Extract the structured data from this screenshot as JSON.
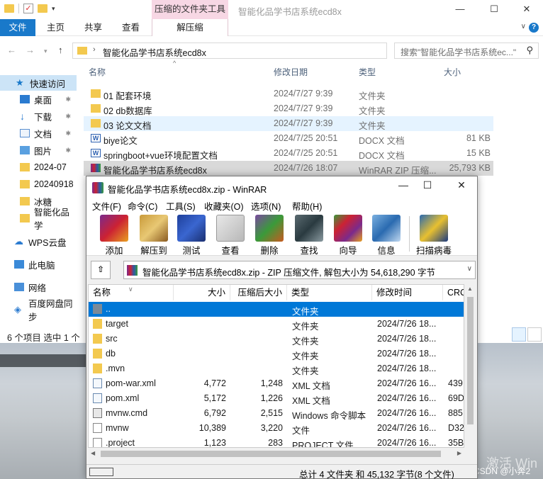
{
  "explorer": {
    "context_tab_title": "压缩的文件夹工具",
    "window_title": "智能化品学书店系统ecd8x",
    "window_controls": [
      "—",
      "☐",
      "✕"
    ],
    "ribbon": {
      "file": "文件",
      "home": "主页",
      "share": "共享",
      "view": "查看",
      "extract": "解压缩"
    },
    "address": {
      "path": "智能化品学书店系统ecd8x",
      "search_placeholder": "搜索\"智能化品学书店系统ec...\""
    },
    "nav_pane": [
      {
        "label": "快速访问",
        "icon": "star-icon",
        "selected": true
      },
      {
        "label": "桌面",
        "icon": "desktop-icon",
        "pinned": true
      },
      {
        "label": "下载",
        "icon": "download-icon",
        "pinned": true
      },
      {
        "label": "文档",
        "icon": "document-icon",
        "pinned": true
      },
      {
        "label": "图片",
        "icon": "picture-icon",
        "pinned": true
      },
      {
        "label": "2024-07",
        "icon": "folder-icon"
      },
      {
        "label": "20240918",
        "icon": "folder-icon"
      },
      {
        "label": "冰糖",
        "icon": "folder-icon"
      },
      {
        "label": "智能化品学",
        "icon": "folder-icon"
      },
      {
        "label": "WPS云盘",
        "icon": "cloud-icon"
      },
      {
        "label": "此电脑",
        "icon": "computer-icon"
      },
      {
        "label": "网络",
        "icon": "network-icon"
      },
      {
        "label": "百度网盘同步",
        "icon": "baidu-icon"
      }
    ],
    "columns": {
      "name": "名称",
      "date": "修改日期",
      "type": "类型",
      "size": "大小"
    },
    "files": [
      {
        "name": "01 配套环境",
        "date": "2024/7/27 9:39",
        "type": "文件夹",
        "size": "",
        "icon": "folder-icon"
      },
      {
        "name": "02 db数据库",
        "date": "2024/7/27 9:39",
        "type": "文件夹",
        "size": "",
        "icon": "folder-icon"
      },
      {
        "name": "03 论文文档",
        "date": "2024/7/27 9:39",
        "type": "文件夹",
        "size": "",
        "icon": "folder-icon"
      },
      {
        "name": "biye论文",
        "date": "2024/7/25 20:51",
        "type": "DOCX 文档",
        "size": "81 KB",
        "icon": "word-doc-icon"
      },
      {
        "name": "springboot+vue环境配置文档",
        "date": "2024/7/25 20:51",
        "type": "DOCX 文档",
        "size": "15 KB",
        "icon": "word-doc-icon"
      },
      {
        "name": "智能化品学书店系统ecd8x",
        "date": "2024/7/26 18:07",
        "type": "WinRAR ZIP 压缩...",
        "size": "25,793 KB",
        "icon": "winrar-archive-icon"
      }
    ],
    "status": "6 个项目   选中 1 个"
  },
  "winrar": {
    "title": "智能化品学书店系统ecd8x.zip - WinRAR",
    "menu": [
      "文件(F)",
      "命令(C)",
      "工具(S)",
      "收藏夹(O)",
      "选项(N)",
      "帮助(H)"
    ],
    "toolbar": [
      {
        "label": "添加",
        "icon": "add-archive-icon"
      },
      {
        "label": "解压到",
        "icon": "extract-to-icon"
      },
      {
        "label": "测试",
        "icon": "test-icon"
      },
      {
        "label": "查看",
        "icon": "view-icon"
      },
      {
        "label": "删除",
        "icon": "delete-icon"
      },
      {
        "label": "查找",
        "icon": "find-icon"
      },
      {
        "label": "向导",
        "icon": "wizard-icon"
      },
      {
        "label": "信息",
        "icon": "info-icon"
      },
      {
        "label": "扫描病毒",
        "icon": "virus-scan-icon"
      }
    ],
    "path_text": "智能化品学书店系统ecd8x.zip - ZIP 压缩文件, 解包大小为 54,618,290 字节",
    "columns": {
      "name": "名称",
      "size": "大小",
      "packed": "压缩后大小",
      "type": "类型",
      "modified": "修改时间",
      "crc": "CRC"
    },
    "entries": [
      {
        "name": "..",
        "size": "",
        "packed": "",
        "type": "文件夹",
        "modified": "",
        "crc": "",
        "icon": "parent-folder-icon",
        "selected": true
      },
      {
        "name": "target",
        "size": "",
        "packed": "",
        "type": "文件夹",
        "modified": "2024/7/26 18...",
        "crc": "",
        "icon": "folder-icon"
      },
      {
        "name": "src",
        "size": "",
        "packed": "",
        "type": "文件夹",
        "modified": "2024/7/26 18...",
        "crc": "",
        "icon": "folder-icon"
      },
      {
        "name": "db",
        "size": "",
        "packed": "",
        "type": "文件夹",
        "modified": "2024/7/26 18...",
        "crc": "",
        "icon": "folder-icon"
      },
      {
        "name": ".mvn",
        "size": "",
        "packed": "",
        "type": "文件夹",
        "modified": "2024/7/26 18...",
        "crc": "",
        "icon": "folder-icon"
      },
      {
        "name": "pom-war.xml",
        "size": "4,772",
        "packed": "1,248",
        "type": "XML 文档",
        "modified": "2024/7/26 16...",
        "crc": "439",
        "icon": "xml-file-icon"
      },
      {
        "name": "pom.xml",
        "size": "5,172",
        "packed": "1,226",
        "type": "XML 文档",
        "modified": "2024/7/26 16...",
        "crc": "69D",
        "icon": "xml-file-icon"
      },
      {
        "name": "mvnw.cmd",
        "size": "6,792",
        "packed": "2,515",
        "type": "Windows 命令脚本",
        "modified": "2024/7/26 16...",
        "crc": "885",
        "icon": "cmd-file-icon"
      },
      {
        "name": "mvnw",
        "size": "10,389",
        "packed": "3,220",
        "type": "文件",
        "modified": "2024/7/26 16...",
        "crc": "D32",
        "icon": "file-icon"
      },
      {
        "name": ".project",
        "size": "1,123",
        "packed": "283",
        "type": "PROJECT 文件",
        "modified": "2024/7/26 16...",
        "crc": "35B",
        "icon": "file-icon"
      }
    ],
    "status": "总计 4 文件夹 和 45,132 字节(8 个文件)"
  },
  "desktop": {
    "watermark": "激活 Win",
    "csdn": "CSDN @小奔2"
  },
  "colors": {
    "accent": "#0078d7",
    "ribbon_file": "#1979ca",
    "context_tab": "#f7d7e4",
    "folder": "#f3c94f"
  }
}
